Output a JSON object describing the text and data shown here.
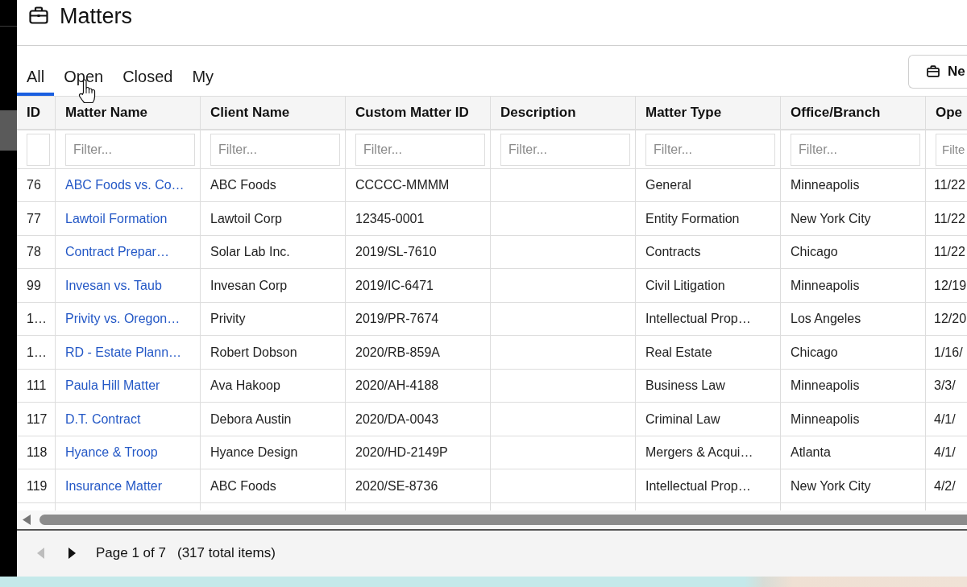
{
  "header": {
    "title": "Matters"
  },
  "tabs": [
    {
      "label": "All",
      "selected": true
    },
    {
      "label": "Open",
      "selected": false
    },
    {
      "label": "Closed",
      "selected": false
    },
    {
      "label": "My",
      "selected": false
    }
  ],
  "new_button": {
    "label": "Ne"
  },
  "table": {
    "columns": [
      {
        "label": "ID"
      },
      {
        "label": "Matter Name",
        "filter": {
          "placeholder": "Filter..."
        }
      },
      {
        "label": "Client Name",
        "filter": {
          "placeholder": "Filter..."
        }
      },
      {
        "label": "Custom Matter ID",
        "filter": {
          "placeholder": "Filter..."
        }
      },
      {
        "label": "Description",
        "filter": {
          "placeholder": "Filter..."
        }
      },
      {
        "label": "Matter Type",
        "filter": {
          "placeholder": "Filter..."
        }
      },
      {
        "label": "Office/Branch",
        "filter": {
          "placeholder": "Filter..."
        }
      },
      {
        "label": "Ope",
        "filter": {
          "placeholder": "Filte"
        }
      }
    ],
    "rows": [
      {
        "id": "76",
        "matter_name": "ABC Foods vs. Co…",
        "client_name": "ABC Foods",
        "custom_matter_id": "CCCCC-MMMM",
        "matter_type": "General",
        "office_branch": "Minneapolis",
        "column_8": "11/22"
      },
      {
        "id": "77",
        "matter_name": "Lawtoil Formation",
        "client_name": "Lawtoil Corp",
        "custom_matter_id": "12345-0001",
        "matter_type": "Entity Formation",
        "office_branch": "New York City",
        "column_8": "11/22"
      },
      {
        "id": "78",
        "matter_name": "Contract Prepar…",
        "client_name": "Solar Lab Inc.",
        "custom_matter_id": "2019/SL-7610",
        "matter_type": "Contracts",
        "office_branch": "Chicago",
        "column_8": "11/22"
      },
      {
        "id": "99",
        "matter_name": "Invesan vs. Taub",
        "client_name": "Invesan Corp",
        "custom_matter_id": "2019/IC-6471",
        "matter_type": "Civil Litigation",
        "office_branch": "Minneapolis",
        "column_8": "12/19"
      },
      {
        "id": "1…",
        "matter_name": "Privity vs. Oregon…",
        "client_name": "Privity",
        "custom_matter_id": "2019/PR-7674",
        "matter_type": "Intellectual Prop…",
        "office_branch": "Los Angeles",
        "column_8": "12/20"
      },
      {
        "id": "1…",
        "matter_name": "RD - Estate Plann…",
        "client_name": "Robert Dobson",
        "custom_matter_id": "2020/RB-859A",
        "matter_type": "Real Estate",
        "office_branch": "Chicago",
        "column_8": "1/16/"
      },
      {
        "id": "111",
        "matter_name": "Paula Hill Matter",
        "client_name": "Ava Hakoop",
        "custom_matter_id": "2020/AH-4188",
        "matter_type": "Business Law",
        "office_branch": "Minneapolis",
        "column_8": "3/3/"
      },
      {
        "id": "117",
        "matter_name": "D.T. Contract",
        "client_name": "Debora Austin",
        "custom_matter_id": "2020/DA-0043",
        "matter_type": "Criminal Law",
        "office_branch": "Minneapolis",
        "column_8": "4/1/"
      },
      {
        "id": "118",
        "matter_name": "Hyance & Troop",
        "client_name": "Hyance Design",
        "custom_matter_id": "2020/HD-2149P",
        "matter_type": "Mergers & Acqui…",
        "office_branch": "Atlanta",
        "column_8": "4/1/"
      },
      {
        "id": "119",
        "matter_name": "Insurance Matter",
        "client_name": "ABC Foods",
        "custom_matter_id": "2020/SE-8736",
        "matter_type": "Intellectual Prop…",
        "office_branch": "New York City",
        "column_8": "4/2/"
      }
    ]
  },
  "pagination": {
    "prev": {
      "disabled": true
    },
    "next": {
      "disabled": false
    },
    "page": "Page 1 of 7",
    "total": "(317 total items)"
  }
}
